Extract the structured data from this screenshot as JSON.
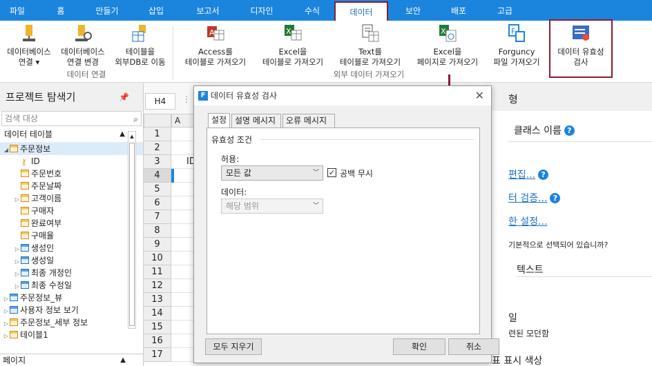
{
  "tabs": [
    "파일",
    "홈",
    "만들기",
    "삽입",
    "보고서",
    "디자인",
    "수식",
    "데이터",
    "보안",
    "배포",
    "고급"
  ],
  "active_tab_index": 7,
  "ribbon": {
    "db_conn": [
      "데이터베이스",
      "연결"
    ],
    "db_change": [
      "데이터베이스",
      "연결 변경"
    ],
    "table_move": [
      "테이블을",
      "외부DB로 이동"
    ],
    "group_data_conn": "데이터 연결",
    "access_import": [
      "Access를",
      "테이블로 가져오기"
    ],
    "excel_import": [
      "Excel을",
      "테이블로 가져오기"
    ],
    "text_import": [
      "Text를",
      "테이블로 가져오기"
    ],
    "excel_page_import": [
      "Excel을",
      "페이지로 가져오기"
    ],
    "forguncy_import": [
      "Forguncy",
      "파일 가져오기"
    ],
    "group_external": "외부 데이터 가져오기",
    "validation": [
      "데이터 유효성",
      "검사"
    ]
  },
  "explorer": {
    "title": "프로젝트 탐색기",
    "search_placeholder": "검색 대상",
    "section_tables": "데이터 테이블",
    "tree": [
      {
        "label": "주문정보",
        "type": "table",
        "level": 0,
        "expanded": true,
        "selected": true
      },
      {
        "label": "ID",
        "type": "key",
        "level": 1
      },
      {
        "label": "주문번호",
        "type": "col",
        "level": 1
      },
      {
        "label": "주문날짜",
        "type": "col",
        "level": 1
      },
      {
        "label": "고객이름",
        "type": "col",
        "level": 1,
        "collapsible": true
      },
      {
        "label": "구매자",
        "type": "col",
        "level": 1
      },
      {
        "label": "완료여부",
        "type": "col",
        "level": 1
      },
      {
        "label": "구매율",
        "type": "col",
        "level": 1
      },
      {
        "label": "생성인",
        "type": "colblue",
        "level": 1,
        "collapsible": true
      },
      {
        "label": "생성일",
        "type": "colblue",
        "level": 1,
        "collapsible": true
      },
      {
        "label": "최종 개정인",
        "type": "colblue",
        "level": 1,
        "collapsible": true
      },
      {
        "label": "최종 수정일",
        "type": "colblue",
        "level": 1,
        "collapsible": true
      },
      {
        "label": "주문정보_뷰",
        "type": "view",
        "level": 0,
        "collapsible": true
      },
      {
        "label": "사용자 정보 보기",
        "type": "view",
        "level": 0,
        "collapsible": true
      },
      {
        "label": "주문정보_세부 정보",
        "type": "table",
        "level": 0,
        "collapsible": true
      },
      {
        "label": "테이블1",
        "type": "table",
        "level": 0,
        "collapsible": true
      }
    ],
    "section_pages": "페이지"
  },
  "sheet": {
    "cell_ref": "H4",
    "col_a": "A",
    "rows": [
      "1",
      "2",
      "3",
      "4",
      "5",
      "6",
      "7",
      "8",
      "9",
      "10",
      "11",
      "12",
      "13",
      "14",
      "15",
      "16",
      "17"
    ],
    "selected_row": "4",
    "cell_peek": "ID"
  },
  "right_panel": {
    "title_fragment": "형",
    "class_name": "클래스 이름",
    "edit_link": "편집...",
    "validate_link": "터 검증...",
    "settings_link": "한 설정...",
    "question": "기본적으로 선택되어 있습니까?",
    "text_label": "텍스트",
    "style_fragment": "일",
    "style_value": "련된 모던함",
    "color_fragment": "표 표시 색상"
  },
  "dialog": {
    "title": "데이터 유효성 검사",
    "tabs": [
      "설정",
      "설명 메시지",
      "오류 메시지"
    ],
    "group": "유효성 조건",
    "allow_label": "허용:",
    "allow_value": "모든 값",
    "ignore_blank": "공백 무시",
    "ignore_blank_checked": true,
    "data_label": "데이터:",
    "data_value": "해당 범위",
    "clear_all": "모두 지우기",
    "ok": "확인",
    "cancel": "취소"
  },
  "colors": {
    "accent": "#1b85dd",
    "highlight": "#8b1a2e"
  }
}
